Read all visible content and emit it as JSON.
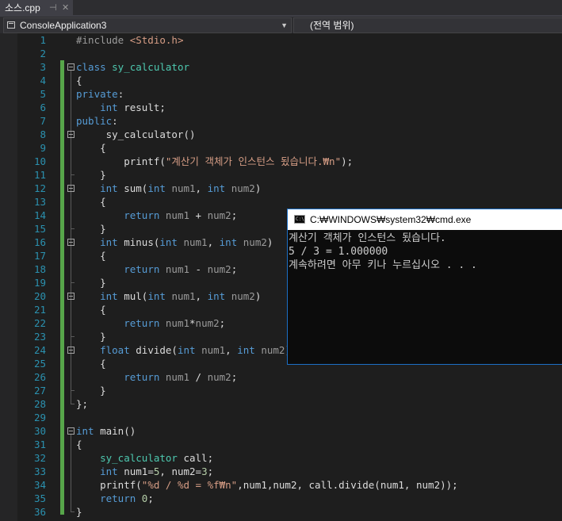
{
  "tab": {
    "title": "소스.cpp",
    "pin_glyph": "⊣",
    "close_glyph": "✕"
  },
  "nav": {
    "project": "ConsoleApplication3",
    "scope": "(전역 범위)",
    "dropdown_glyph": "▼"
  },
  "editor": {
    "line_numbers": [
      "1",
      "2",
      "3",
      "4",
      "5",
      "6",
      "7",
      "8",
      "9",
      "10",
      "11",
      "12",
      "13",
      "14",
      "15",
      "16",
      "17",
      "18",
      "19",
      "20",
      "21",
      "22",
      "23",
      "24",
      "25",
      "26",
      "27",
      "28",
      "29",
      "30",
      "31",
      "32",
      "33",
      "34",
      "35",
      "36"
    ],
    "lines": [
      [
        [
          "pp",
          "#include "
        ],
        [
          "st",
          "<Stdio.h>"
        ]
      ],
      [],
      [
        [
          "kw",
          "class "
        ],
        [
          "ty",
          "sy_calculator"
        ]
      ],
      [
        [
          "",
          "{"
        ]
      ],
      [
        [
          "kw",
          "private"
        ],
        [
          "",
          ":"
        ]
      ],
      [
        [
          "",
          "    "
        ],
        [
          "kw",
          "int "
        ],
        [
          "",
          "result;"
        ]
      ],
      [
        [
          "kw",
          "public"
        ],
        [
          "",
          ":"
        ]
      ],
      [
        [
          "",
          "     sy_calculator()"
        ]
      ],
      [
        [
          "",
          "    {"
        ]
      ],
      [
        [
          "",
          "        printf("
        ],
        [
          "st",
          "\"계산기 객체가 인스턴스 됬습니다.₩n\""
        ],
        [
          "",
          ");"
        ]
      ],
      [
        [
          "",
          "    }"
        ]
      ],
      [
        [
          "",
          "    "
        ],
        [
          "kw",
          "int "
        ],
        [
          "",
          "sum("
        ],
        [
          "kw",
          "int "
        ],
        [
          "pa",
          "num1"
        ],
        [
          "",
          ", "
        ],
        [
          "kw",
          "int "
        ],
        [
          "pa",
          "num2"
        ],
        [
          "",
          ")"
        ]
      ],
      [
        [
          "",
          "    {"
        ]
      ],
      [
        [
          "",
          "        "
        ],
        [
          "kw",
          "return "
        ],
        [
          "pa",
          "num1"
        ],
        [
          "",
          " + "
        ],
        [
          "pa",
          "num2"
        ],
        [
          "",
          ";"
        ]
      ],
      [
        [
          "",
          "    }"
        ]
      ],
      [
        [
          "",
          "    "
        ],
        [
          "kw",
          "int "
        ],
        [
          "",
          "minus("
        ],
        [
          "kw",
          "int "
        ],
        [
          "pa",
          "num1"
        ],
        [
          "",
          ", "
        ],
        [
          "kw",
          "int "
        ],
        [
          "pa",
          "num2"
        ],
        [
          "",
          ")"
        ]
      ],
      [
        [
          "",
          "    {"
        ]
      ],
      [
        [
          "",
          "        "
        ],
        [
          "kw",
          "return "
        ],
        [
          "pa",
          "num1"
        ],
        [
          "",
          " - "
        ],
        [
          "pa",
          "num2"
        ],
        [
          "",
          ";"
        ]
      ],
      [
        [
          "",
          "    }"
        ]
      ],
      [
        [
          "",
          "    "
        ],
        [
          "kw",
          "int "
        ],
        [
          "",
          "mul("
        ],
        [
          "kw",
          "int "
        ],
        [
          "pa",
          "num1"
        ],
        [
          "",
          ", "
        ],
        [
          "kw",
          "int "
        ],
        [
          "pa",
          "num2"
        ],
        [
          "",
          ")"
        ]
      ],
      [
        [
          "",
          "    {"
        ]
      ],
      [
        [
          "",
          "        "
        ],
        [
          "kw",
          "return "
        ],
        [
          "pa",
          "num1"
        ],
        [
          "",
          "*"
        ],
        [
          "pa",
          "num2"
        ],
        [
          "",
          ";"
        ]
      ],
      [
        [
          "",
          "    }"
        ]
      ],
      [
        [
          "",
          "    "
        ],
        [
          "kw",
          "float "
        ],
        [
          "",
          "divide("
        ],
        [
          "kw",
          "int "
        ],
        [
          "pa",
          "num1"
        ],
        [
          "",
          ", "
        ],
        [
          "kw",
          "int "
        ],
        [
          "pa",
          "num2"
        ],
        [
          "",
          ")"
        ]
      ],
      [
        [
          "",
          "    {"
        ]
      ],
      [
        [
          "",
          "        "
        ],
        [
          "kw",
          "return "
        ],
        [
          "pa",
          "num1"
        ],
        [
          "",
          " / "
        ],
        [
          "pa",
          "num2"
        ],
        [
          "",
          ";"
        ]
      ],
      [
        [
          "",
          "    }"
        ]
      ],
      [
        [
          "",
          "};"
        ]
      ],
      [],
      [
        [
          "kw",
          "int "
        ],
        [
          "",
          "main()"
        ]
      ],
      [
        [
          "",
          "{"
        ]
      ],
      [
        [
          "",
          "    "
        ],
        [
          "ty",
          "sy_calculator "
        ],
        [
          "",
          "call;"
        ]
      ],
      [
        [
          "",
          "    "
        ],
        [
          "kw",
          "int "
        ],
        [
          "",
          "num1="
        ],
        [
          "nu",
          "5"
        ],
        [
          "",
          ", num2="
        ],
        [
          "nu",
          "3"
        ],
        [
          "",
          ";"
        ]
      ],
      [
        [
          "",
          "    printf("
        ],
        [
          "st",
          "\"%d / %d = %f₩n\""
        ],
        [
          "",
          ",num1,num2, call.divide(num1, num2));"
        ]
      ],
      [
        [
          "",
          "    "
        ],
        [
          "kw",
          "return "
        ],
        [
          "nu",
          "0"
        ],
        [
          "",
          ";"
        ]
      ],
      [
        [
          "",
          "}"
        ]
      ]
    ]
  },
  "console": {
    "title": "C:₩WINDOWS₩system32₩cmd.exe",
    "lines": [
      "계산기 객체가 인스턴스 됬습니다.",
      "5 / 3 = 1.000000",
      "계속하려면 아무 키나 누르십시오 . . ."
    ]
  },
  "colors": {
    "keyword": "#569cd6",
    "type": "#4ec9b0",
    "string": "#d69d85",
    "number": "#b5cea8",
    "line_number": "#2b91af",
    "change_bar": "#57a64a",
    "editor_bg": "#1e1e1e"
  }
}
